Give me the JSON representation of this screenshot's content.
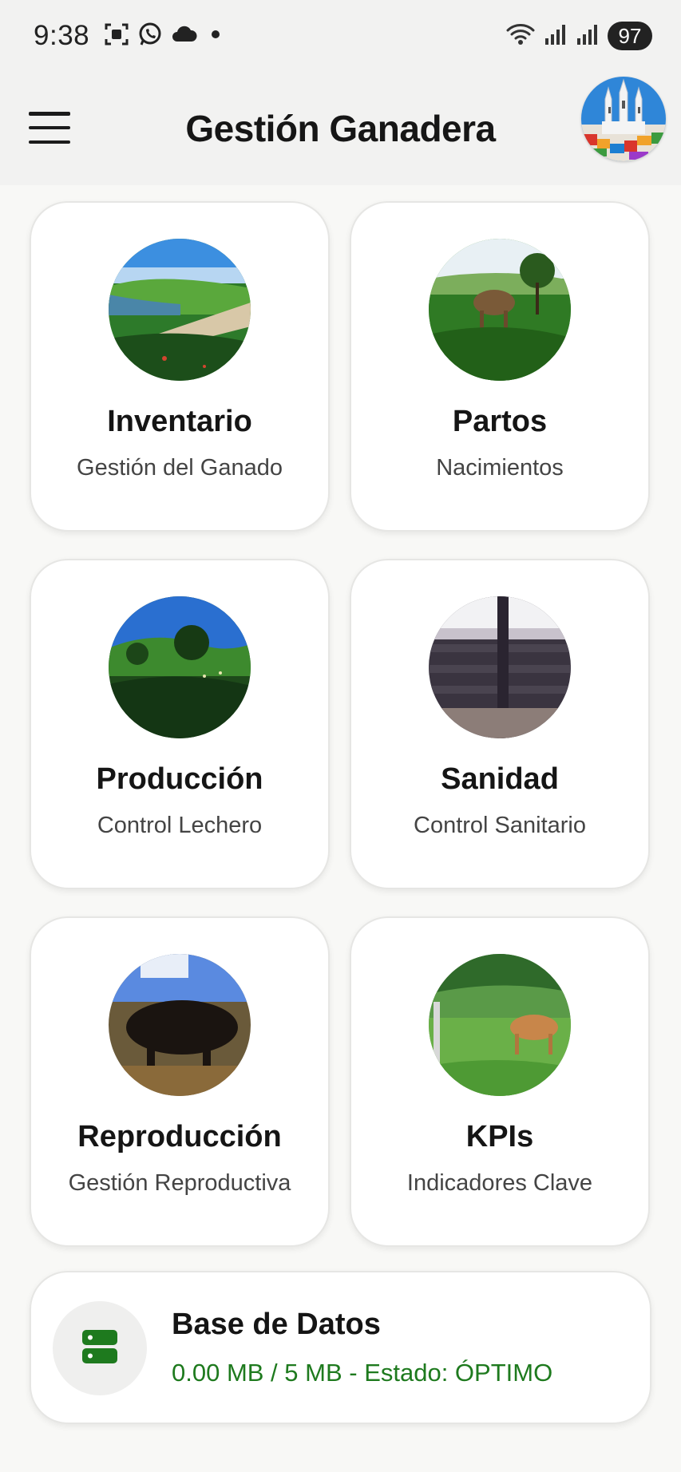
{
  "status_bar": {
    "time": "9:38",
    "left_icons": [
      "screenshot-icon",
      "whatsapp-icon",
      "cloud-icon",
      "dot-icon"
    ],
    "right_icons": [
      "wifi-icon",
      "signal-icon",
      "signal-icon"
    ],
    "battery": "97"
  },
  "app_bar": {
    "menu_icon": "menu-icon",
    "title": "Gestión Ganadera",
    "avatar": "profile-avatar"
  },
  "modules": [
    {
      "id": "inventario",
      "title": "Inventario",
      "subtitle": "Gestión del Ganado"
    },
    {
      "id": "partos",
      "title": "Partos",
      "subtitle": "Nacimientos"
    },
    {
      "id": "produccion",
      "title": "Producción",
      "subtitle": "Control Lechero"
    },
    {
      "id": "sanidad",
      "title": "Sanidad",
      "subtitle": "Control Sanitario"
    },
    {
      "id": "reproduccion",
      "title": "Reproducción",
      "subtitle": "Gestión Reproductiva"
    },
    {
      "id": "kpis",
      "title": "KPIs",
      "subtitle": "Indicadores Clave"
    }
  ],
  "database": {
    "icon": "database-icon",
    "title": "Base de Datos",
    "status": "0.00 MB / 5 MB - Estado: ÓPTIMO"
  },
  "colors": {
    "accent_green": "#1e7a1e",
    "background": "#f8f8f6",
    "app_bar": "#f2f2f1"
  }
}
